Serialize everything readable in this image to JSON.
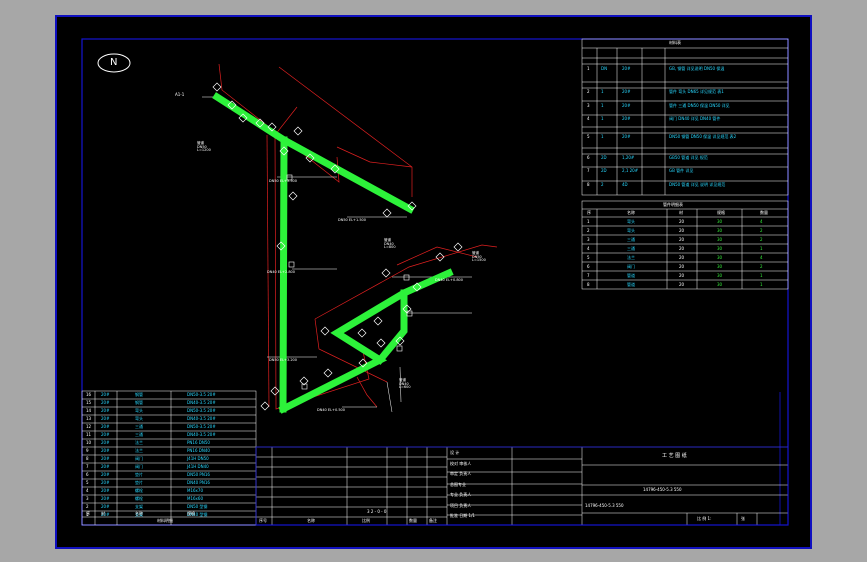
{
  "drawing": {
    "north_symbol": "N",
    "colors": {
      "background": "#000000",
      "frame": "#1414d0",
      "pipe": "#2df23a",
      "reference_lines": "#e02020",
      "text_cyan": "#28d8ff",
      "text_white": "#ffffff"
    }
  },
  "title_block": {
    "drawing_number_a": "14796-450-5.3 550",
    "drawing_number_b": "14796-450-5.3 550",
    "title_label": "工 艺 图 纸",
    "scale_label": "比 例 1:",
    "sheet_label": "张",
    "approval_labels": [
      "设 计",
      "校对 审核人",
      "审定 负责人",
      "总图专业",
      "专业 负责人",
      "项目 负责人",
      "批准 日期 1/1"
    ],
    "bottom_header": [
      "序号",
      "名称",
      "比例",
      "数量",
      "备注"
    ],
    "mid_label": "3 2 - 0 - 0"
  },
  "tables": {
    "legend_title": "材料表",
    "legend_rows": [
      [
        "1",
        "DN",
        "20#",
        "GB, 钢管 详见说明 DN50 保温"
      ],
      [
        "2",
        "1",
        "20#",
        "管件 弯头 DN65 详见规范 表1"
      ],
      [
        "3",
        "1",
        "20#",
        "管件 三通 DN50 保温 DN50 详见"
      ],
      [
        "4",
        "1",
        "20#",
        "阀门 DN40 详见 DN40 管件"
      ],
      [
        "5",
        "1",
        "20#",
        "DN50 钢管 DN50 保温 详见规范 表2"
      ],
      [
        "6",
        "2D",
        "1,20#",
        "GB50 管道 详见 规范"
      ],
      [
        "7",
        "2D",
        "2,1 20#",
        "GB 管件 详见"
      ],
      [
        "8",
        "2",
        "4D",
        "DN50 管道 详见 说明 详见规范"
      ]
    ],
    "parts_title": "管件明细表",
    "parts_rows": [
      [
        "序",
        "名称",
        "材",
        "规格",
        "数量"
      ],
      [
        "1",
        "弯头",
        "20",
        "30",
        "4"
      ],
      [
        "2",
        "弯头",
        "20",
        "30",
        "2"
      ],
      [
        "3",
        "三通",
        "20",
        "30",
        "2"
      ],
      [
        "4",
        "三通",
        "20",
        "30",
        "1"
      ],
      [
        "5",
        "法兰",
        "20",
        "30",
        "4"
      ],
      [
        "6",
        "阀门",
        "20",
        "30",
        "2"
      ],
      [
        "7",
        "管道",
        "20",
        "30",
        "1"
      ],
      [
        "8",
        "管道",
        "20",
        "30",
        "1"
      ]
    ],
    "left_rows": [
      [
        "16",
        "20#",
        "钢管",
        "DN50-3.5 20#"
      ],
      [
        "15",
        "20#",
        "钢管",
        "DN40-3.5 20#"
      ],
      [
        "14",
        "20#",
        "弯头",
        "DN50-3.5 20#"
      ],
      [
        "13",
        "20#",
        "弯头",
        "DN40-3.5 20#"
      ],
      [
        "12",
        "20#",
        "三通",
        "DN50-3.5 20#"
      ],
      [
        "11",
        "20#",
        "三通",
        "DN40-3.5 20#"
      ],
      [
        "10",
        "20#",
        "法兰",
        "PN16 DN50"
      ],
      [
        "9",
        "20#",
        "法兰",
        "PN16 DN40"
      ],
      [
        "8",
        "20#",
        "阀门",
        "J41H DN50"
      ],
      [
        "7",
        "20#",
        "阀门",
        "J41H DN40"
      ],
      [
        "6",
        "20#",
        "垫片",
        "DN50 PN16"
      ],
      [
        "5",
        "20#",
        "垫片",
        "DN40 PN16"
      ],
      [
        "4",
        "20#",
        "螺栓",
        "M16x70"
      ],
      [
        "3",
        "20#",
        "螺栓",
        "M16x60"
      ],
      [
        "2",
        "20#",
        "支架",
        "DN50 型钢"
      ],
      [
        "1",
        "20#",
        "支架",
        "DN40 型钢"
      ]
    ],
    "left_header": [
      "序",
      "材",
      "名称",
      "规格"
    ],
    "left_title": "材料明细"
  },
  "annotations": {
    "top_left": "A1-1",
    "tags": [
      "DN50 EL+3.500",
      "DN40 EL+2.800",
      "DN50 EL+1.500",
      "DN40 EL+0.800",
      "DN50 EL+3.200",
      "DN40 EL+0.500"
    ],
    "elev_notes": [
      "管道 DN50 L=1200",
      "管道 DN40 L=800",
      "管道 DN50 L=1500",
      "管道 DN40 L=600"
    ]
  }
}
